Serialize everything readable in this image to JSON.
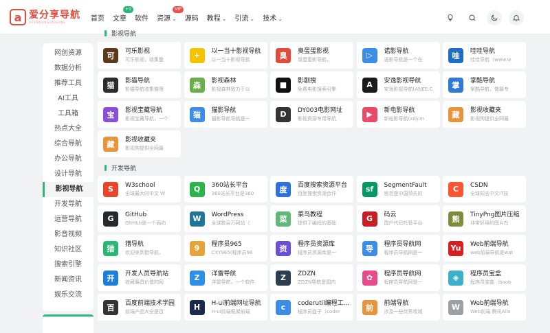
{
  "logo": {
    "mark": "a",
    "title": "爱分享导航",
    "subtitle": "AIFENXIANGDAOHANG"
  },
  "nav": [
    {
      "label": "首页"
    },
    {
      "label": "文章",
      "badge": "+1",
      "badge_color": "green"
    },
    {
      "label": "软件"
    },
    {
      "label": "资源",
      "badge": "VIP",
      "badge_color": "red",
      "caret": "⌄"
    },
    {
      "label": "源码"
    },
    {
      "label": "教程",
      "caret": "⌄"
    },
    {
      "label": "引流",
      "caret": "⌄"
    },
    {
      "label": "技术",
      "caret": "⌄"
    }
  ],
  "top_icons": [
    "lightbulb-icon",
    "search-icon",
    "moon-icon",
    "bell-icon"
  ],
  "sidebar": {
    "items": [
      "网创资源",
      "数据分析",
      "推荐工具",
      "AI工具",
      "工具箱",
      "热点大全",
      "综合导航",
      "办公导航",
      "设计导航",
      "影视导航",
      "开发导航",
      "运营导航",
      "影音视频",
      "知识社区",
      "搜索引擎",
      "新闻资讯",
      "娱乐交流"
    ],
    "active": "影视导航"
  },
  "sections": [
    {
      "title": "影视导航",
      "cards": [
        {
          "title": "可乐影视",
          "desc": "可乐影视，收集整",
          "icon": "可",
          "color": "#5a3a1a"
        },
        {
          "title": "以一当十影视导航",
          "desc": "以一当十影视导航",
          "icon": "+",
          "color": "#f5c400"
        },
        {
          "title": "臭蛋蛋影视",
          "desc": "臭蛋蛋影导航，",
          "icon": "臭",
          "color": "#e24a3b"
        },
        {
          "title": "诺影导航",
          "desc": "诺影导航是一个在",
          "icon": "▷",
          "color": "#3b8de8"
        },
        {
          "title": "哇哇导航",
          "desc": "哇哇导航（www.w",
          "icon": "哇",
          "color": "#1e6ec8"
        },
        {
          "title": "影猫导航",
          "desc": "影猫导航收集整理",
          "icon": "猫",
          "color": "#2c2c2c"
        },
        {
          "title": "影视森林",
          "desc": "影视森林致力于以",
          "icon": "森",
          "color": "#6ab04c"
        },
        {
          "title": "影剧搜",
          "desc": "免费电影搜索引擎",
          "icon": "■",
          "color": "#111111"
        },
        {
          "title": "安逸影视导航",
          "desc": "安逸影视导航(ANEE.C",
          "icon": "A",
          "color": "#1a1a1a"
        },
        {
          "title": "掌酷导航",
          "desc": "掌酷导航，做最专",
          "icon": "掌",
          "color": "#2f7ad9"
        },
        {
          "title": "影视宝藏导航",
          "desc": "影视宝藏导航，一个",
          "icon": "宝",
          "color": "#8a4fd8"
        },
        {
          "title": "猫影导航",
          "desc": "猫影导航导航是一",
          "icon": "猫",
          "color": "#3b8de8"
        },
        {
          "title": "DY003电影网址",
          "desc": "影视资源专用导航",
          "icon": "D",
          "color": "#333333"
        },
        {
          "title": "新电影导航",
          "desc": "新电影导航(xdy.m",
          "icon": "▶",
          "color": "#e84a6a"
        },
        {
          "title": "影视收藏夹",
          "desc": "影视狗提供全网最",
          "icon": "藏",
          "color": "#e8943b"
        },
        {
          "title": "影视收藏夹",
          "desc": "影视狗提供全网最",
          "icon": "藏",
          "color": "#e8943b"
        }
      ]
    },
    {
      "title": "开发导航",
      "cards": [
        {
          "title": "W3school",
          "desc": "全球最大的中文 W",
          "icon": "S",
          "color": "#e8452c"
        },
        {
          "title": "360站长平台",
          "desc": "360站长平台是360",
          "icon": "Q",
          "color": "#2cb34a"
        },
        {
          "title": "百度搜索资源平台",
          "desc": "百度搜索资源合作",
          "icon": "度",
          "color": "#2f6fe0"
        },
        {
          "title": "SegmentFault",
          "desc": "思否是中国领先的",
          "icon": "sf",
          "color": "#009a61"
        },
        {
          "title": "CSDN",
          "desc": "全球知名中文IT技",
          "icon": "C",
          "color": "#fc5531"
        },
        {
          "title": "GitHub",
          "desc": "GitHub是一个面向",
          "icon": "G",
          "color": "#24292e"
        },
        {
          "title": "WordPress",
          "desc": "全球数百万网站（",
          "icon": "W",
          "color": "#21759b"
        },
        {
          "title": "菜鸟教程",
          "desc": "提供了编程的基础",
          "icon": "菜",
          "color": "#5fb878"
        },
        {
          "title": "码云",
          "desc": "国产代码托管平台",
          "icon": "G",
          "color": "#c71d23"
        },
        {
          "title": "TinyPng图片压缩",
          "desc": "非常好用的图片在",
          "icon": "熊",
          "color": "#7f8c3d"
        },
        {
          "title": "猎导航",
          "desc": "欢迎来到猎导航，",
          "icon": "猎",
          "color": "#2bb673"
        },
        {
          "title": "程序员965",
          "desc": "CXY965(程序员96",
          "icon": "9",
          "color": "#e8a23b"
        },
        {
          "title": "程序员资源库",
          "desc": "程序员资源库是一",
          "icon": "资",
          "color": "#6a4fd8"
        },
        {
          "title": "程序员导航网",
          "desc": "程序员导航网是一",
          "icon": "导",
          "color": "#3b8de8"
        },
        {
          "title": "Web前端导航",
          "desc": "web前端导航是wat",
          "icon": "Yu",
          "color": "#d81e1e"
        },
        {
          "title": "开发人员导航站",
          "desc": "收藏最具价值的网",
          "icon": "开",
          "color": "#1f7fd8"
        },
        {
          "title": "洋雷导航",
          "desc": "洋雷导航，一个软件",
          "icon": "Z",
          "color": "#2f8fe8"
        },
        {
          "title": "ZDZN",
          "desc": "ZDZN导航是国内",
          "icon": "Z",
          "color": "#2c3e50"
        },
        {
          "title": "程序员导航网",
          "desc": "程序员导航网是一",
          "icon": "✿",
          "color": "#e84a8a"
        },
        {
          "title": "程序员宝盒",
          "desc": "程序员宝盒（baob",
          "icon": "◈",
          "color": "#3bb0c8"
        },
        {
          "title": "百度前端技术学园",
          "desc": "前端产品大全是百",
          "icon": "百",
          "color": "#333333"
        },
        {
          "title": "H-ui前端网址导航",
          "desc": "H-ui前端框架前端",
          "icon": "H",
          "color": "#1a2a4a"
        },
        {
          "title": "coderutil编程工...",
          "desc": "程序员盒子（coder",
          "icon": "c",
          "color": "#3b8de8"
        },
        {
          "title": "前端导航",
          "desc": "涉及一些优秀攻城",
          "icon": "前",
          "color": "#e8943b"
        },
        {
          "title": "Web前端导航",
          "desc": "Web前端 腾讯Allo",
          "icon": "W",
          "color": "#9aa0a6"
        }
      ]
    }
  ]
}
